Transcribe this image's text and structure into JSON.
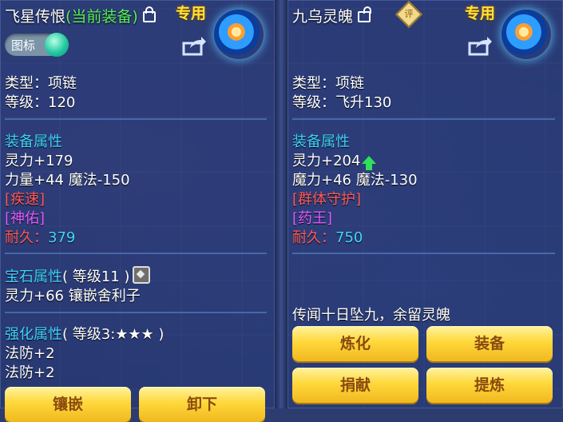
{
  "left_panel": {
    "name": "飞星传恨",
    "status": "(当前装备)",
    "special": "专用",
    "icon_toggle": "图标",
    "type": "类型：项链",
    "level": "等级：120",
    "attr_header": "装备属性",
    "attrs": [
      "灵力+179",
      "力量+44 魔法-150"
    ],
    "effect1": "[疾速]",
    "effect2": "[神佑]",
    "durability_label": "耐久：",
    "durability": "379",
    "gem_header": "宝石属性",
    "gem_level": "( 等级11 )",
    "gem_attr": "灵力+66 镶嵌舍利子",
    "enhance_header": "强化属性",
    "enhance_level": "( 等级3:★★★ )",
    "enhance_attrs": [
      "法防+2",
      "法防+2"
    ],
    "buttons": [
      "镶嵌",
      "卸下"
    ]
  },
  "right_panel": {
    "name": "九乌灵魄",
    "rating": "评",
    "special": "专用",
    "type": "类型：项链",
    "level": "等级：飞升130",
    "attr_header": "装备属性",
    "attrs": [
      "灵力+204",
      "魔力+46 魔法-130"
    ],
    "effect1": "[群体守护]",
    "effect2": "[药王]",
    "durability_label": "耐久：",
    "durability": "750",
    "lore": "传闻十日坠九，余留灵魄",
    "buttons": [
      "炼化",
      "装备",
      "捐献",
      "提炼"
    ]
  },
  "colors": {
    "panel": "#2c3b70",
    "attr_header": "#3fd2ff",
    "status_green": "#58f05a",
    "special_gold": "#ffe23a",
    "button_gold": "#ffd83a"
  }
}
